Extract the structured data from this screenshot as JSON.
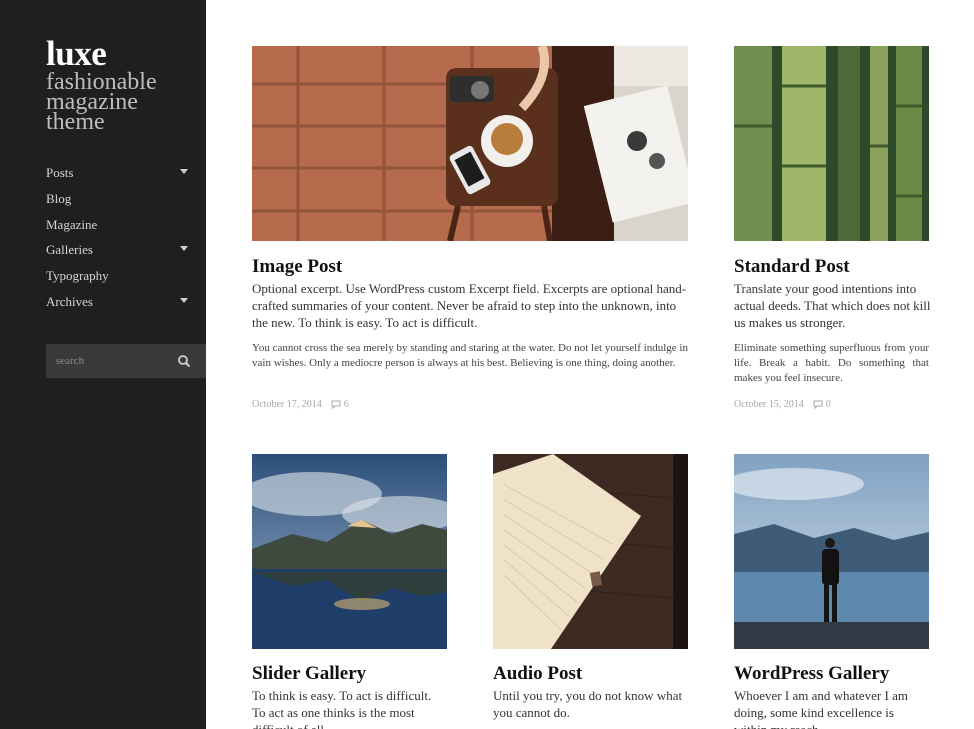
{
  "site": {
    "title": "luxe",
    "tagline": "fashionable magazine theme"
  },
  "nav": {
    "items": [
      {
        "label": "Posts",
        "has_submenu": true
      },
      {
        "label": "Blog",
        "has_submenu": false
      },
      {
        "label": "Magazine",
        "has_submenu": false
      },
      {
        "label": "Galleries",
        "has_submenu": true
      },
      {
        "label": "Typography",
        "has_submenu": false
      },
      {
        "label": "Archives",
        "has_submenu": true
      }
    ]
  },
  "search": {
    "placeholder": "search",
    "icon": "search-icon"
  },
  "posts": [
    {
      "title": "Image Post",
      "excerpt": "Optional excerpt. Use WordPress custom Excerpt field. Excerpts are optional hand-crafted summaries of your content. Never be afraid to step into the unknown, into the new. To think is easy. To act is difficult.",
      "body": "You cannot cross the sea merely by standing and staring at the water. Do not let yourself indulge in vain wishes. Only a mediocre person is always at his best. Believing is one thing, doing another.",
      "date": "October 17, 2014",
      "comments": "6"
    },
    {
      "title": "Standard Post",
      "excerpt": "Translate your good intentions into actual deeds. That which does not kill us makes us stronger.",
      "body": "Eliminate something superfluous from your life. Break a habit. Do something that makes you feel insecure.",
      "date": "October 15, 2014",
      "comments": "0"
    },
    {
      "title": "Slider Gallery",
      "excerpt": "To think is easy. To act is difficult. To act as one thinks is the most difficult of all."
    },
    {
      "title": "Audio Post",
      "excerpt": "Until you try, you do not know what you cannot do."
    },
    {
      "title": "WordPress Gallery",
      "excerpt": "Whoever I am and whatever I am doing, some kind excellence is within my reach."
    }
  ],
  "colors": {
    "sidebar_bg": "#1f1f1f",
    "search_bg": "#3a3a3a",
    "meta_text": "#a6a6a6"
  }
}
